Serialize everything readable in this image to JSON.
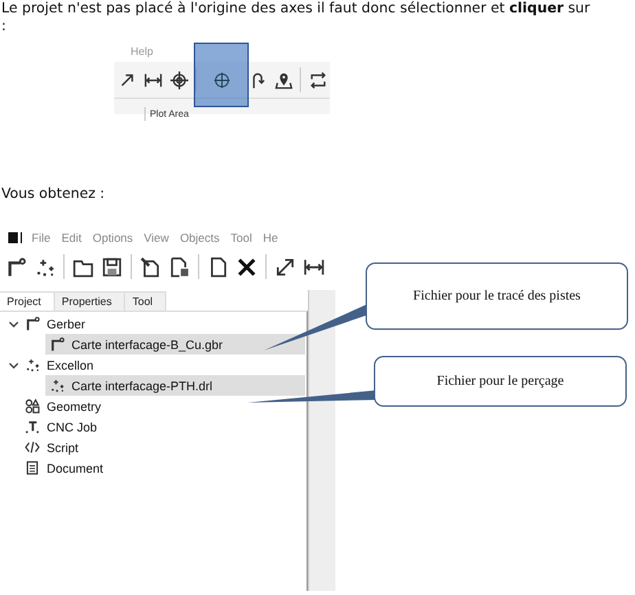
{
  "intro": "Le projet n'est pas placé à l'origine des axes il faut donc sélectionner et **cliquer** sur :",
  "snippet": {
    "menu": "Help",
    "tab": "Plot Area",
    "tools": [
      {
        "kind": "arrow"
      },
      {
        "kind": "measure"
      },
      {
        "kind": "target"
      },
      {
        "kind": "origin",
        "selected": true
      },
      {
        "kind": "hook"
      },
      {
        "kind": "pin"
      },
      {
        "kind": "swap"
      }
    ]
  },
  "result": "Vous obtenez :",
  "app": {
    "menu": [
      "File",
      "Edit",
      "Options",
      "View",
      "Objects",
      "Tool",
      "He"
    ],
    "tools": [
      {
        "kind": "gerber"
      },
      {
        "kind": "sparkle"
      },
      {
        "kind": "folder"
      },
      {
        "kind": "save"
      },
      {
        "kind": "edit"
      },
      {
        "kind": "docsave"
      },
      {
        "kind": "page"
      },
      {
        "kind": "delete"
      },
      {
        "kind": "resize"
      },
      {
        "kind": "measure"
      }
    ],
    "tabs": [
      {
        "label": "Project",
        "selected": true
      },
      {
        "label": "Properties",
        "selected": false
      },
      {
        "label": "Tool",
        "selected": false
      }
    ],
    "tree": [
      {
        "label": "Gerber",
        "kind": "gerber",
        "expanded": true,
        "selected": false,
        "children": [
          {
            "label": "Carte interfacage-B_Cu.gbr",
            "kind": "gerber",
            "selected": true
          }
        ]
      },
      {
        "label": "Excellon",
        "kind": "sparkle",
        "expanded": true,
        "selected": false,
        "children": [
          {
            "label": "Carte interfacage-PTH.drl",
            "kind": "sparkle",
            "selected": true
          }
        ]
      },
      {
        "label": "Geometry",
        "kind": "geometry",
        "selected": false
      },
      {
        "label": "CNC Job",
        "kind": "cnc",
        "selected": false
      },
      {
        "label": "Script",
        "kind": "script",
        "selected": false
      },
      {
        "label": "Document",
        "kind": "document",
        "selected": false
      }
    ]
  },
  "callouts": [
    "Fichier pour le tracé des pistes",
    "Fichier pour le perçage"
  ]
}
